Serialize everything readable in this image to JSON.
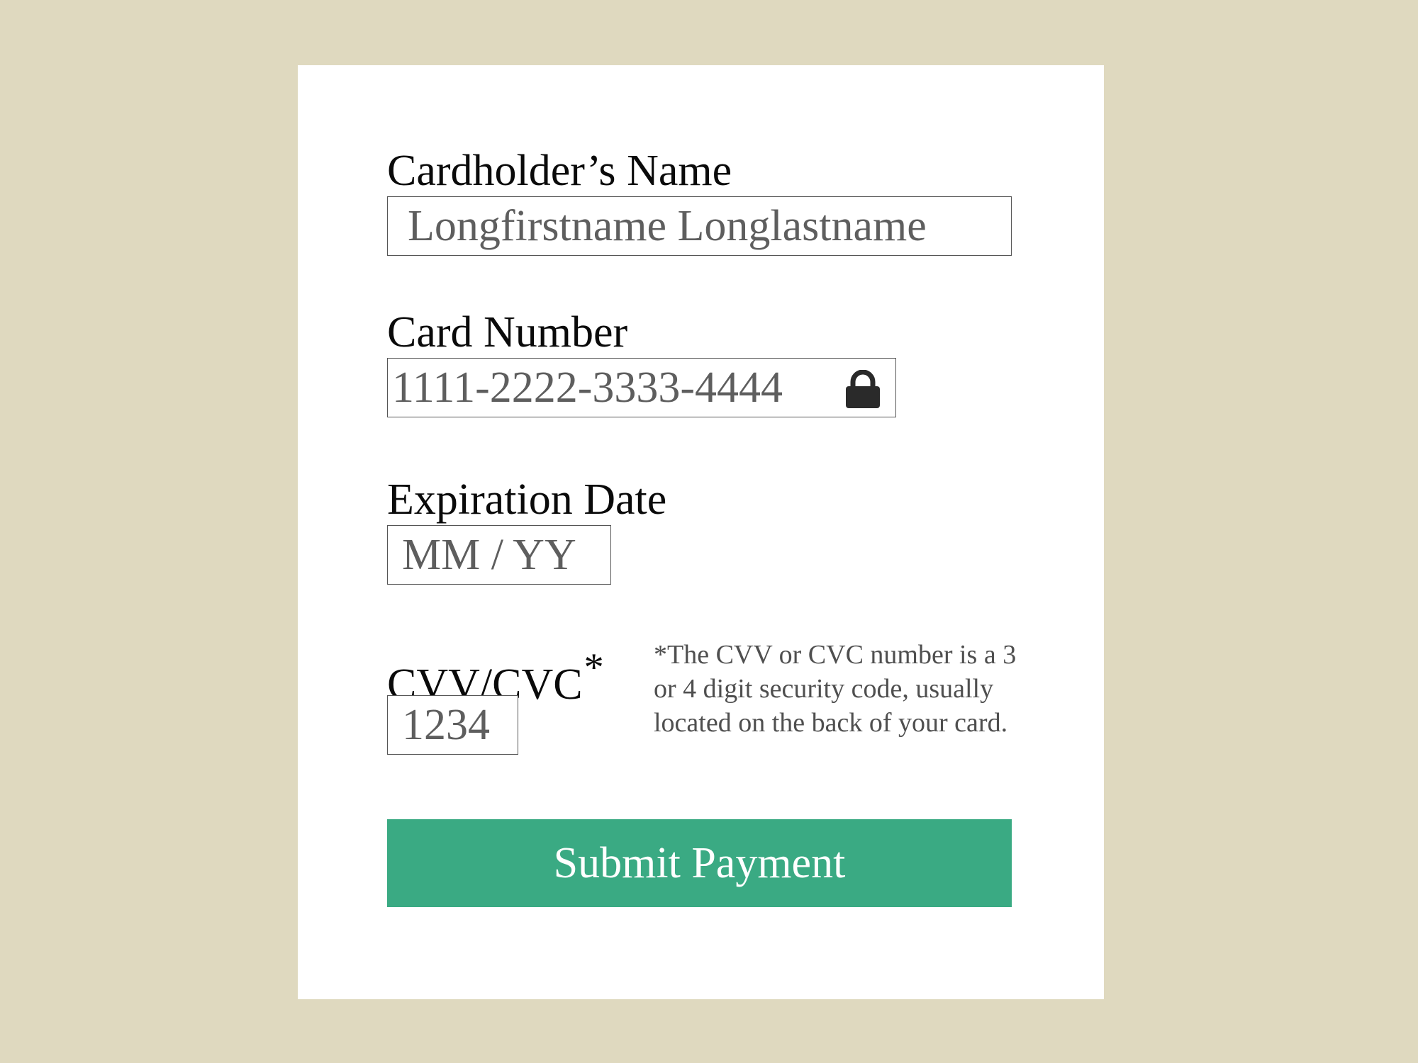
{
  "form": {
    "name_label": "Cardholder’s Name",
    "name_value": "Longfirstname Longlastname",
    "card_label": "Card Number",
    "card_value": "1111-2222-3333-4444",
    "card_icon": "lock-icon",
    "expiration_label": "Expiration Date",
    "expiration_placeholder": "MM / YY",
    "cvv_label": "CVV/CVC",
    "cvv_asterisk": "*",
    "cvv_value": "1234",
    "cvv_help": "*The CVV or CVC number is a 3 or 4 digit security code, usually located on the back of your card.",
    "submit_label": "Submit Payment"
  },
  "colors": {
    "background": "#dfd9bf",
    "panel": "#ffffff",
    "submit_button": "#3aaa83",
    "input_text": "#5e5e5e",
    "lock_icon": "#2a2a2a"
  }
}
